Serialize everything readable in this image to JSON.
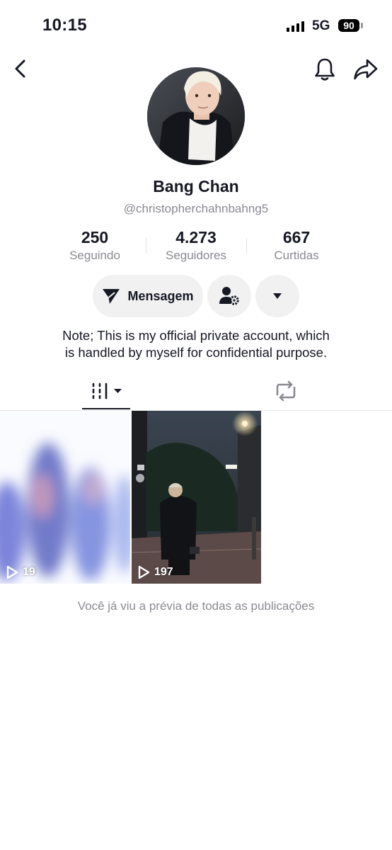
{
  "status_bar": {
    "time": "10:15",
    "network": "5G",
    "battery": "90"
  },
  "profile": {
    "name": "Bang Chan",
    "handle": "@christopherchahnbahng5",
    "bio_line1": "Note; This is my official private account, which",
    "bio_line2": "is handled by myself for confidential purpose."
  },
  "stats": [
    {
      "value": "250",
      "label": "Seguindo"
    },
    {
      "value": "4.273",
      "label": "Seguidores"
    },
    {
      "value": "667",
      "label": "Curtidas"
    }
  ],
  "actions": {
    "message_label": "Mensagem"
  },
  "videos": [
    {
      "views": "19"
    },
    {
      "views": "197"
    }
  ],
  "footer_text": "Você já viu a prévia de todas as publicações",
  "icons": {
    "back": "chevron-left-icon",
    "notifications": "bell-icon",
    "share": "share-arrow-icon",
    "message": "send-icon",
    "add_friend": "person-gear-icon",
    "more": "caret-down-icon",
    "videos_tab": "grid-icon",
    "reposts_tab": "repost-icon",
    "play": "play-icon"
  },
  "colors": {
    "text": "#161823",
    "muted": "#8a8b91",
    "button_bg": "#f1f1f2"
  }
}
